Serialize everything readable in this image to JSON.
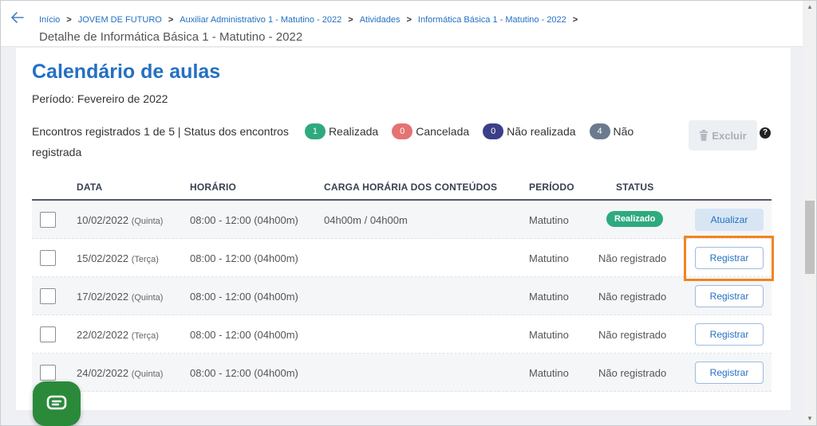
{
  "breadcrumb": {
    "items": [
      "Início",
      "JOVEM DE FUTURO",
      "Auxiliar Administrativo 1 - Matutino - 2022",
      "Atividades",
      "Informática Básica 1 - Matutino - 2022"
    ],
    "separator": ">"
  },
  "header": {
    "title": "Detalhe de Informática Básica 1 - Matutino - 2022"
  },
  "main": {
    "heading": "Calendário de aulas",
    "period": "Período: Fevereiro de 2022",
    "summary_prefix": "Encontros registrados 1 de 5 | Status dos encontros",
    "status_counts": [
      {
        "count": "1",
        "label": "Realizada",
        "color": "#2eaa7e"
      },
      {
        "count": "0",
        "label": "Cancelada",
        "color": "#e57373"
      },
      {
        "count": "0",
        "label": "Não realizada",
        "color": "#3b3f87"
      },
      {
        "count": "4",
        "label": "Não registrada",
        "color": "#6b7a8f"
      }
    ],
    "delete_label": "Excluir",
    "help_icon": "?"
  },
  "table": {
    "headers": [
      "DATA",
      "HORÁRIO",
      "CARGA HORÁRIA DOS CONTEÚDOS",
      "PERÍODO",
      "STATUS"
    ],
    "rows": [
      {
        "date": "10/02/2022",
        "weekday": "(Quinta)",
        "time": "08:00 - 12:00 (04h00m)",
        "load": "04h00m / 04h00m",
        "period": "Matutino",
        "status": "Realizado",
        "action": "Atualizar"
      },
      {
        "date": "15/02/2022",
        "weekday": "(Terça)",
        "time": "08:00 - 12:00 (04h00m)",
        "load": "",
        "period": "Matutino",
        "status": "Não registrado",
        "action": "Registrar"
      },
      {
        "date": "17/02/2022",
        "weekday": "(Quinta)",
        "time": "08:00 - 12:00 (04h00m)",
        "load": "",
        "period": "Matutino",
        "status": "Não registrado",
        "action": "Registrar"
      },
      {
        "date": "22/02/2022",
        "weekday": "(Terça)",
        "time": "08:00 - 12:00 (04h00m)",
        "load": "",
        "period": "Matutino",
        "status": "Não registrado",
        "action": "Registrar"
      },
      {
        "date": "24/02/2022",
        "weekday": "(Quinta)",
        "time": "08:00 - 12:00 (04h00m)",
        "load": "",
        "period": "Matutino",
        "status": "Não registrado",
        "action": "Registrar"
      }
    ]
  },
  "colors": {
    "accent": "#2470c2",
    "success": "#2eaa7e",
    "highlight": "#f08421",
    "chat": "#2a8a3a"
  },
  "icons": {
    "back": "arrow-left-icon",
    "delete": "trash-icon",
    "help": "help-circle-icon",
    "chat": "chat-icon"
  }
}
